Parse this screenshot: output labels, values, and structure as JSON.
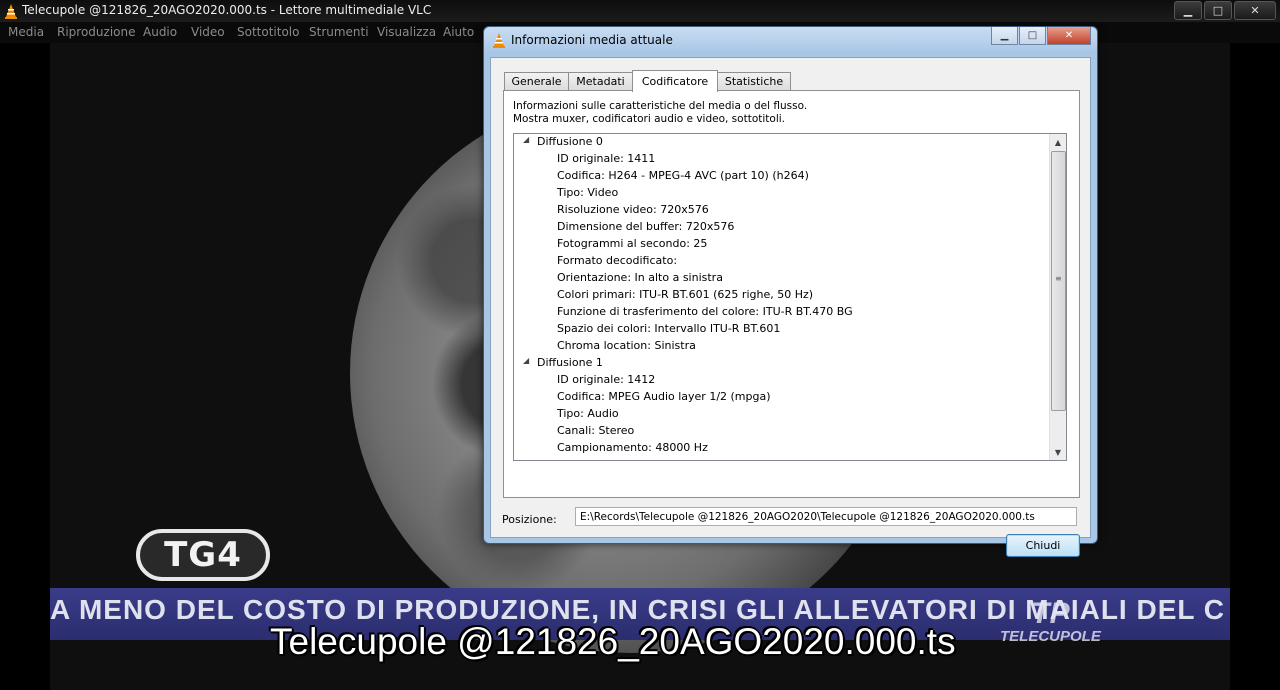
{
  "window": {
    "title": "Telecupole @121826_20AGO2020.000.ts - Lettore multimediale VLC",
    "icons": [
      "vlc-cone-icon",
      "minimize-icon",
      "maximize-icon",
      "close-icon"
    ]
  },
  "menu": [
    "Media",
    "Riproduzione",
    "Audio",
    "Video",
    "Sottotitolo",
    "Strumenti",
    "Visualizza",
    "Aiuto"
  ],
  "video": {
    "channel_logo": "TG4",
    "ticker": "A MENO DEL COSTO DI PRODUZIONE, IN CRISI GLI ALLEVATORI DI MAIALI DEL C",
    "station_logo": {
      "mark": "TP",
      "name": "TELECUPOLE"
    },
    "subtitle": "Telecupole @121826_20AGO2020.000.ts"
  },
  "dialog": {
    "title": "Informazioni media attuale",
    "tabs": [
      "Generale",
      "Metadati",
      "Codificatore",
      "Statistiche"
    ],
    "active_tab": "Codificatore",
    "description": [
      "Informazioni sulle caratteristiche del media o del flusso.",
      "Mostra muxer, codificatori audio e video, sottotitoli."
    ],
    "streams": [
      {
        "label": "Diffusione 0",
        "items": [
          "ID originale: 1411",
          "Codifica: H264 - MPEG-4 AVC (part 10) (h264)",
          "Tipo: Video",
          "Risoluzione video: 720x576",
          "Dimensione del buffer: 720x576",
          "Fotogrammi al secondo: 25",
          "Formato decodificato:",
          "Orientazione: In alto a sinistra",
          "Colori primari: ITU-R BT.601 (625 righe, 50 Hz)",
          "Funzione di trasferimento del colore: ITU-R BT.470 BG",
          "Spazio dei colori: Intervallo ITU-R BT.601",
          "Chroma location: Sinistra"
        ]
      },
      {
        "label": "Diffusione 1",
        "items": [
          "ID originale: 1412",
          "Codifica: MPEG Audio layer 1/2 (mpga)",
          "Tipo: Audio",
          "Canali: Stereo",
          "Campionamento: 48000 Hz"
        ]
      }
    ],
    "position_label": "Posizione:",
    "position_value": "E:\\Records\\Telecupole @121826_20AGO2020\\Telecupole @121826_20AGO2020.000.ts",
    "close_button": "Chiudi"
  }
}
